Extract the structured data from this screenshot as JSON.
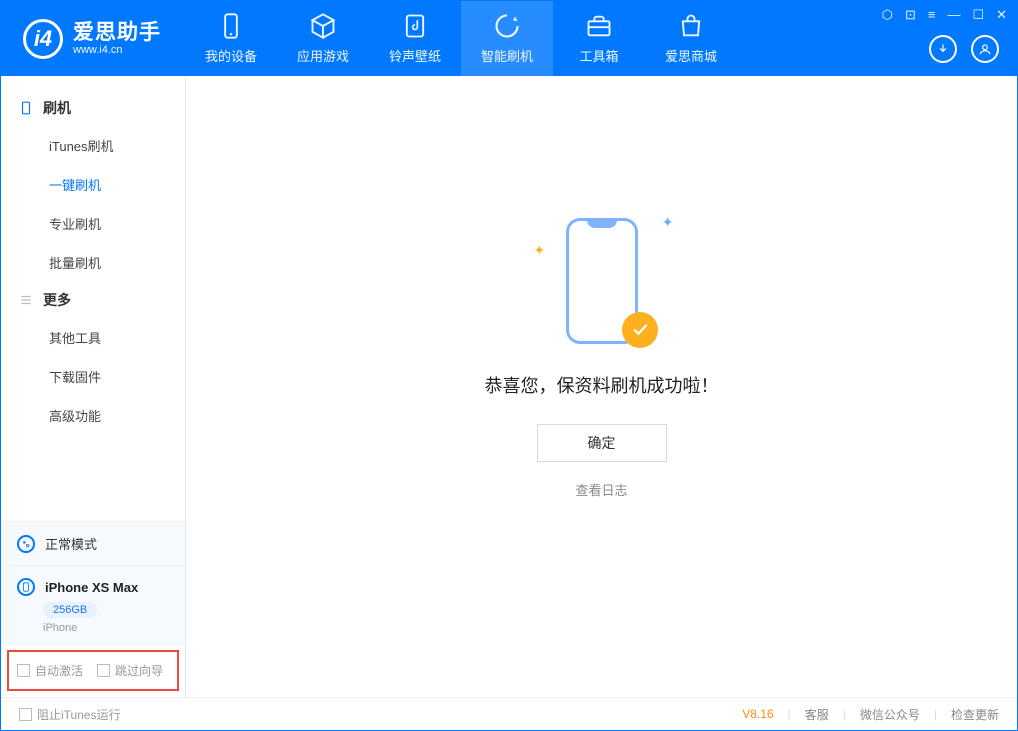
{
  "app": {
    "title": "爱思助手",
    "url": "www.i4.cn"
  },
  "tabs": [
    {
      "label": "我的设备"
    },
    {
      "label": "应用游戏"
    },
    {
      "label": "铃声壁纸"
    },
    {
      "label": "智能刷机"
    },
    {
      "label": "工具箱"
    },
    {
      "label": "爱思商城"
    }
  ],
  "sidebar": {
    "section1": "刷机",
    "items1": [
      "iTunes刷机",
      "一键刷机",
      "专业刷机",
      "批量刷机"
    ],
    "section2": "更多",
    "items2": [
      "其他工具",
      "下载固件",
      "高级功能"
    ]
  },
  "device": {
    "mode": "正常模式",
    "name": "iPhone XS Max",
    "storage": "256GB",
    "type": "iPhone"
  },
  "checks": {
    "autoActivate": "自动激活",
    "skipGuide": "跳过向导"
  },
  "main": {
    "message": "恭喜您，保资料刷机成功啦！",
    "ok": "确定",
    "viewLog": "查看日志"
  },
  "status": {
    "blockItunes": "阻止iTunes运行",
    "version": "V8.16",
    "support": "客服",
    "wechat": "微信公众号",
    "checkUpdate": "检查更新"
  }
}
